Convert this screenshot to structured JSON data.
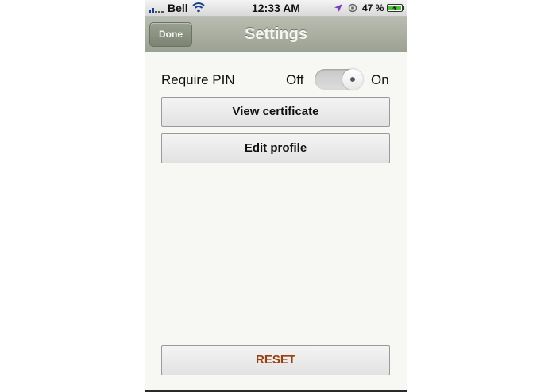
{
  "status_bar": {
    "carrier": "Bell",
    "time": "12:33 AM",
    "battery_percent": "47 %"
  },
  "nav_bar": {
    "done_label": "Done",
    "title": "Settings"
  },
  "settings": {
    "require_pin_label": "Require PIN",
    "off_label": "Off",
    "on_label": "On",
    "require_pin_enabled": false
  },
  "buttons": {
    "view_certificate": "View certificate",
    "edit_profile": "Edit profile",
    "reset": "RESET"
  },
  "colors": {
    "nav_bar": "#a7ad9d",
    "background": "#f7f8f3",
    "reset_text": "#9a3d0e"
  },
  "icons": [
    "signal-bars-icon",
    "wifi-icon",
    "location-arrow-icon",
    "orientation-lock-icon",
    "battery-charging-icon"
  ]
}
